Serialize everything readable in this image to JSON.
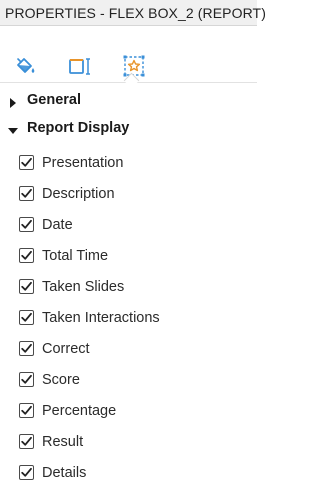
{
  "panel": {
    "title": "PROPERTIES - FLEX BOX_2 (REPORT)"
  },
  "tabs": [
    {
      "icon": "paint-bucket-icon"
    },
    {
      "icon": "resize-box-icon"
    },
    {
      "icon": "star-selection-icon",
      "active": true
    }
  ],
  "sections": {
    "general": {
      "label": "General",
      "expanded": false
    },
    "report_display": {
      "label": "Report Display",
      "expanded": true
    }
  },
  "report_display_items": [
    {
      "label": "Presentation",
      "checked": true
    },
    {
      "label": "Description",
      "checked": true
    },
    {
      "label": "Date",
      "checked": true
    },
    {
      "label": "Total Time",
      "checked": true
    },
    {
      "label": "Taken Slides",
      "checked": true
    },
    {
      "label": "Taken Interactions",
      "checked": true
    },
    {
      "label": "Correct",
      "checked": true
    },
    {
      "label": "Score",
      "checked": true
    },
    {
      "label": "Percentage",
      "checked": true
    },
    {
      "label": "Result",
      "checked": true
    },
    {
      "label": "Details",
      "checked": true
    }
  ],
  "colors": {
    "accent_blue": "#3a8fd8",
    "accent_orange": "#e8942a"
  }
}
